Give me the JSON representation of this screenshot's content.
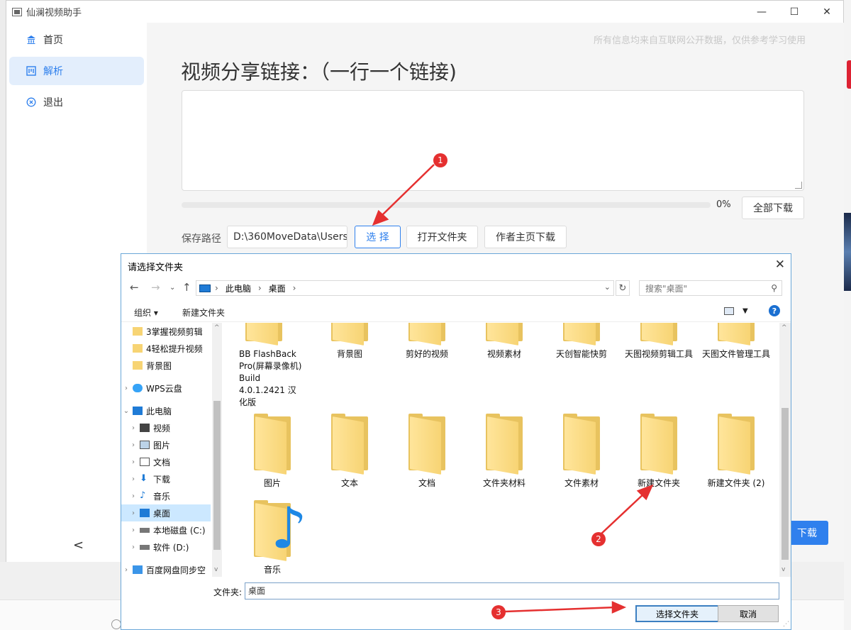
{
  "app": {
    "title": "仙澜视频助手",
    "disclaimer": "所有信息均来自互联网公开数据，仅供参考学习使用"
  },
  "window_controls": {
    "minimize": "—",
    "maximize": "☐",
    "close": "✕"
  },
  "sidebar": {
    "items": [
      {
        "label": "首页",
        "icon": "bank-icon"
      },
      {
        "label": "解析",
        "icon": "board-icon",
        "active": true
      },
      {
        "label": "退出",
        "icon": "close-circle-icon"
      }
    ],
    "collapse_glyph": "<"
  },
  "main": {
    "heading": "视频分享链接：（一行一个链接)",
    "progress": {
      "value": 0,
      "label": "0%"
    },
    "download_all": "全部下载",
    "save_path_label": "保存路径",
    "save_path_value": "D:\\360MoveData\\Users\\",
    "choose": "选 择",
    "open_folder": "打开文件夹",
    "author_download": "作者主页下载",
    "background_partial_button": "下载"
  },
  "dialog": {
    "title": "请选择文件夹",
    "close": "✕",
    "breadcrumb": [
      "此电脑",
      "桌面"
    ],
    "search_placeholder": "搜索\"桌面\"",
    "toolbar": {
      "organize": "组织 ▾",
      "new_folder": "新建文件夹"
    },
    "tree": [
      {
        "label": "3掌握视频剪辑",
        "kind": "folder"
      },
      {
        "label": "4轻松提升视频",
        "kind": "folder"
      },
      {
        "label": "背景图",
        "kind": "folder"
      },
      {
        "label": "WPS云盘",
        "kind": "cloud",
        "expandable": true
      },
      {
        "label": "此电脑",
        "kind": "pc",
        "expanded": true
      },
      {
        "label": "视频",
        "kind": "video",
        "expandable": true
      },
      {
        "label": "图片",
        "kind": "picture",
        "expandable": true
      },
      {
        "label": "文档",
        "kind": "doc",
        "expandable": true
      },
      {
        "label": "下载",
        "kind": "download",
        "expandable": true
      },
      {
        "label": "音乐",
        "kind": "music",
        "expandable": true
      },
      {
        "label": "桌面",
        "kind": "desktop",
        "expandable": true,
        "selected": true
      },
      {
        "label": "本地磁盘 (C:)",
        "kind": "drive",
        "expandable": true
      },
      {
        "label": "软件 (D:)",
        "kind": "drive",
        "expandable": true
      },
      {
        "label": "百度网盘同步空",
        "kind": "baidu",
        "expandable": true
      }
    ],
    "items_top": [
      "BB FlashBack Pro(屏幕录像机) Build 4.0.1.2421 汉化版",
      "背景图",
      "剪好的视频",
      "视频素材",
      "天创智能快剪",
      "天图视频剪辑工具",
      "天图文件管理工具"
    ],
    "items_row2": [
      "图片",
      "文本",
      "文档",
      "文件夹材料",
      "文件素材",
      "新建文件夹",
      "新建文件夹 (2)"
    ],
    "items_row3": [
      "音乐"
    ],
    "folder_label": "文件夹:",
    "folder_value": "桌面",
    "select_button": "选择文件夹",
    "cancel_button": "取消"
  },
  "annotations": [
    "1",
    "2",
    "3"
  ],
  "colors": {
    "accent": "#2f80ed",
    "marker": "#e53030",
    "folder": "#f7d474"
  }
}
